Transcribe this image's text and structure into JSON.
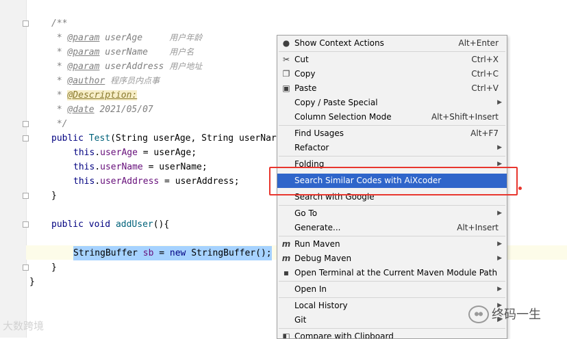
{
  "editor": {
    "lines": {
      "doc_open": "/**",
      "p1": {
        "star": " * ",
        "tag": "@param",
        "name": "userAge",
        "desc": "用户年龄"
      },
      "p2": {
        "star": " * ",
        "tag": "@param",
        "name": "userName",
        "desc": "用户名"
      },
      "p3": {
        "star": " * ",
        "tag": "@param",
        "name": "userAddress",
        "desc": "用户地址"
      },
      "author": {
        "star": " * ",
        "tag": "@author",
        "desc": "程序员内点事"
      },
      "description": {
        "star": " * ",
        "tag": "@Description:"
      },
      "date": {
        "star": " * ",
        "tag": "@date",
        "desc": "2021/05/07"
      },
      "doc_close": " */",
      "ctor": {
        "kw": "public",
        "name": "Test",
        "params": "(String userAge, String userNar"
      },
      "assign1": {
        "kw": "this",
        "field": "userAge",
        "rest": " = userAge;"
      },
      "assign2": {
        "kw": "this",
        "field": "userName",
        "rest": " = userName;"
      },
      "assign3": {
        "kw": "this",
        "field": "userAddress",
        "rest": " = userAddress;"
      },
      "close_brace": "}",
      "method": {
        "kw1": "public",
        "kw2": "void",
        "name": "addUser",
        "rest": "(){"
      },
      "selected": {
        "type": "StringBuffer",
        "var": "sb",
        "eq": " = ",
        "kw": "new",
        "call": "StringBuffer();"
      },
      "method_close": "}",
      "class_close": "}"
    }
  },
  "context_menu": {
    "items": [
      {
        "label": "Show Context Actions",
        "shortcut": "Alt+Enter",
        "icon": "lightbulb-icon"
      },
      {
        "label": "Cut",
        "shortcut": "Ctrl+X",
        "icon": "scissors-icon"
      },
      {
        "label": "Copy",
        "shortcut": "Ctrl+C",
        "icon": "copy-icon"
      },
      {
        "label": "Paste",
        "shortcut": "Ctrl+V",
        "icon": "clipboard-icon"
      },
      {
        "label": "Copy / Paste Special",
        "submenu": true
      },
      {
        "label": "Column Selection Mode",
        "shortcut": "Alt+Shift+Insert"
      },
      {
        "label": "Find Usages",
        "shortcut": "Alt+F7"
      },
      {
        "label": "Refactor",
        "submenu": true
      },
      {
        "label": "Folding",
        "submenu": true
      },
      {
        "label": "Search Similar Codes with AiXcoder",
        "active": true
      },
      {
        "label": "Search with Google"
      },
      {
        "label": "Go To",
        "submenu": true
      },
      {
        "label": "Generate...",
        "shortcut": "Alt+Insert"
      },
      {
        "label": "Run Maven",
        "submenu": true,
        "icon": "maven-icon"
      },
      {
        "label": "Debug Maven",
        "submenu": true,
        "icon": "maven-icon"
      },
      {
        "label": "Open Terminal at the Current Maven Module Path",
        "icon": "terminal-icon"
      },
      {
        "label": "Open In",
        "submenu": true
      },
      {
        "label": "Local History",
        "submenu": true
      },
      {
        "label": "Git",
        "submenu": true
      },
      {
        "label": "Compare with Clipboard",
        "icon": "compare-icon"
      }
    ]
  },
  "icons": {
    "arrow": "▶",
    "lightbulb": "💡",
    "scissors": "✂",
    "copy": "❐",
    "clipboard": "📋",
    "maven": "m"
  },
  "watermarks": {
    "left": "大数跨境",
    "right": "终码一生"
  },
  "colors": {
    "accent": "#2f65ca",
    "annotation": "#e8352d",
    "selection": "#a6d2ff"
  }
}
